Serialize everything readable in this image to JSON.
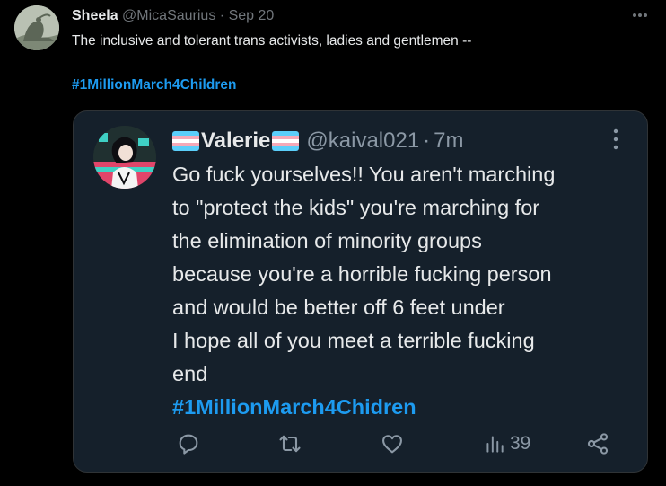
{
  "tweet": {
    "display_name": "Sheela",
    "handle": "@MicaSaurius",
    "separator": "·",
    "date": "Sep 20",
    "text": "The inclusive and tolerant trans activists, ladies and gentlemen --",
    "hashtag": "#1MillionMarch4Children",
    "more_icon": "more-horizontal-icon"
  },
  "quoted": {
    "flag_icon": "transgender-flag-icon",
    "display_name": "Valerie",
    "handle": "@kaival021",
    "separator": "·",
    "time": "7m",
    "more_icon": "more-vertical-icon",
    "lines": [
      "Go fuck yourselves!! You aren't marching",
      "to \"protect the kids\" you're marching for",
      "the elimination of minority groups",
      "because you're a horrible fucking person",
      "and would be better off 6 feet under",
      "I hope all of you meet a terrible fucking",
      "end"
    ],
    "hashtag": "#1MillionMarch4Chidren",
    "actions": {
      "reply_icon": "reply-icon",
      "repost_icon": "repost-icon",
      "like_icon": "heart-icon",
      "views_icon": "views-icon",
      "views_count": "39",
      "share_icon": "share-icon"
    }
  },
  "colors": {
    "background": "#000000",
    "card_background": "#15202b",
    "text": "#e7e9ea",
    "muted": "#71767b",
    "accent": "#1d9bf0",
    "flag_blue": "#5bcefa",
    "flag_pink": "#f5a9b8",
    "flag_white": "#ffffff"
  }
}
